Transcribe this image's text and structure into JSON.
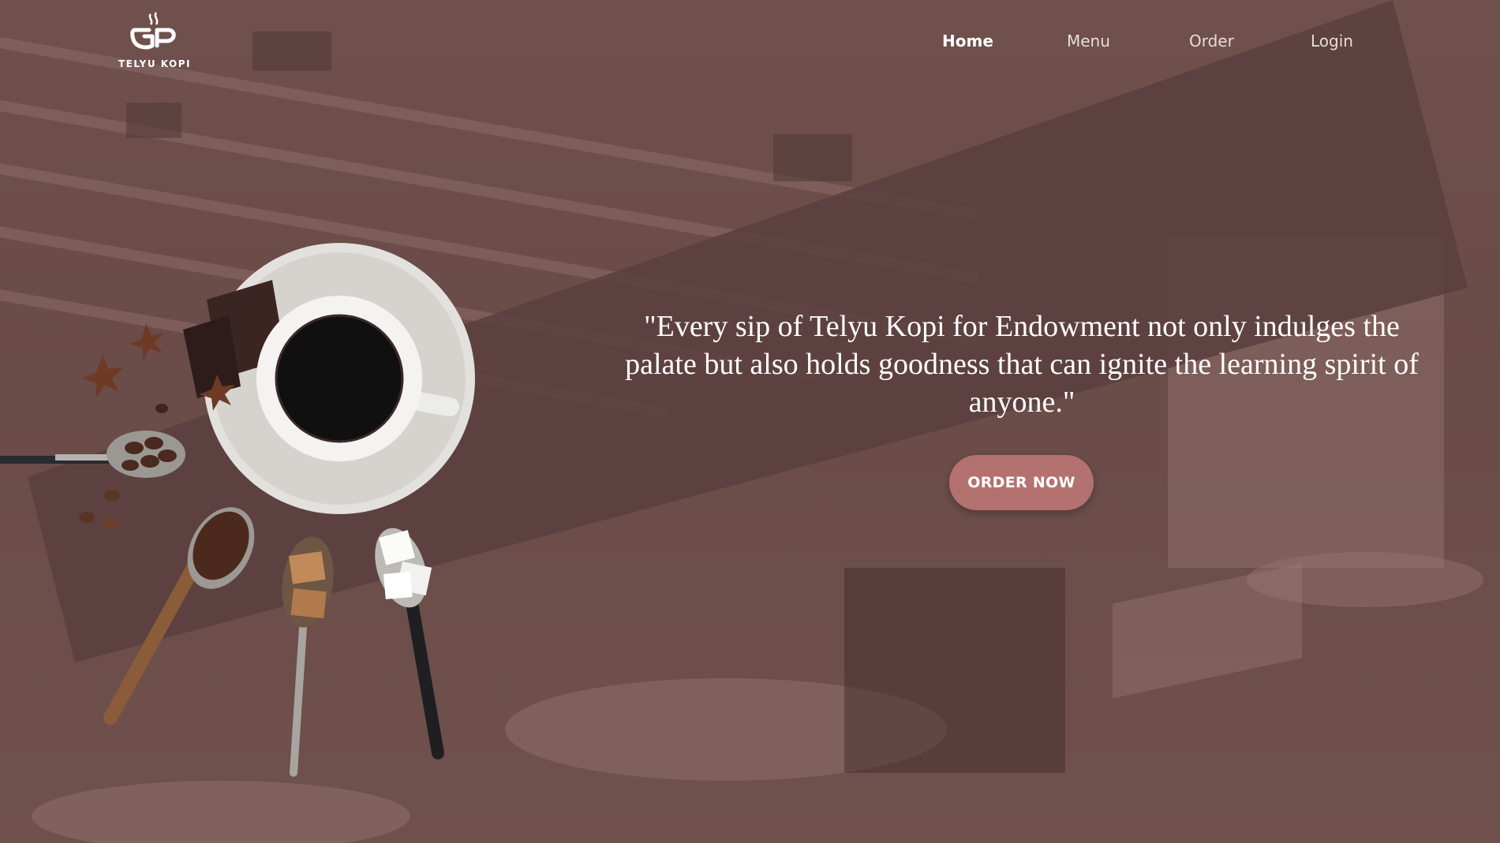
{
  "brand": {
    "name": "TELYU KOPI"
  },
  "nav": {
    "items": [
      {
        "label": "Home",
        "active": true
      },
      {
        "label": "Menu",
        "active": false
      },
      {
        "label": "Order",
        "active": false
      },
      {
        "label": "Login",
        "active": false
      }
    ]
  },
  "hero": {
    "quote": "\"Every sip of Telyu Kopi for Endowment not only indulges the palate but also holds goodness that can ignite the learning spirit of anyone.\"",
    "cta_label": "ORDER NOW"
  },
  "colors": {
    "background_overlay": "#6b4c49",
    "banner": "#5b403f",
    "cta": "#b3726f",
    "text": "#ffffff"
  }
}
